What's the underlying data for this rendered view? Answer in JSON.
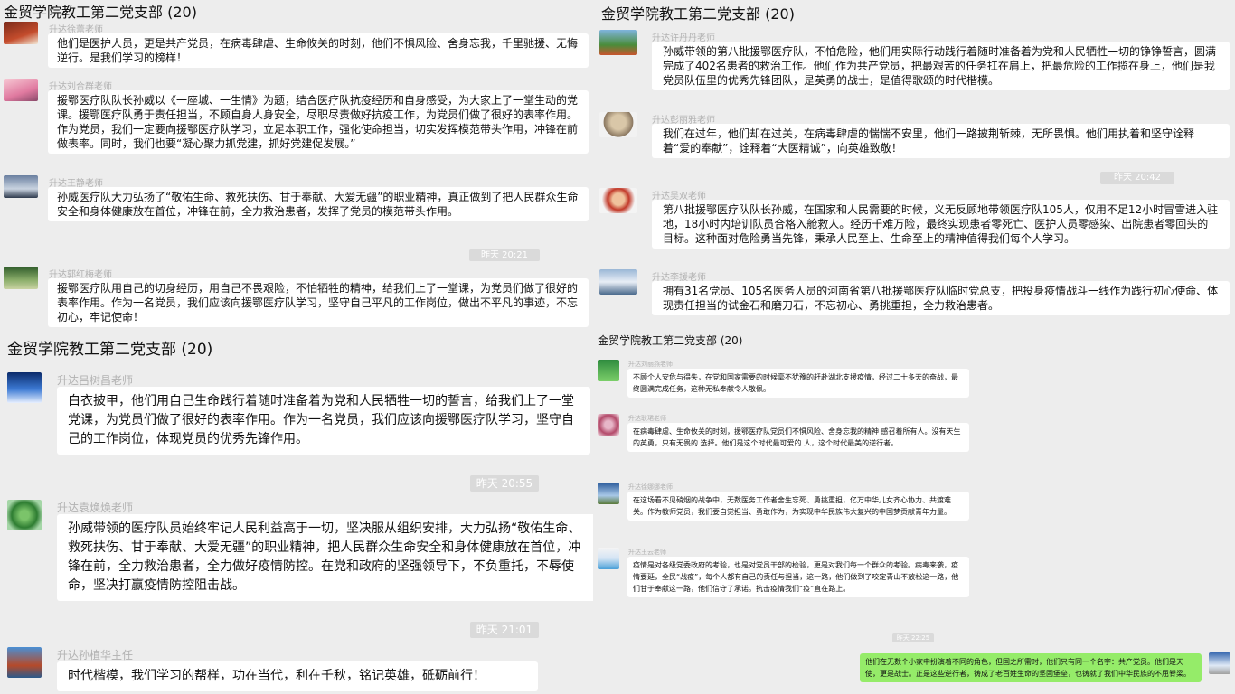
{
  "group_title": "金贸学院教工第二党支部 (20)",
  "top_left": {
    "messages": [
      {
        "sender": "升达徐蕾老师",
        "text": "他们是医护人员，更是共产党员，在病毒肆虐、生命攸关的时刻，他们不惧风险、舍身忘我，千里驰援、无悔逆行。是我们学习的榜样！"
      },
      {
        "sender": "升达刘合群老师",
        "text": "援鄂医疗队队长孙威以《一座城、一生情》为题，结合医疗队抗疫经历和自身感受，为大家上了一堂生动的党课。援鄂医疗队勇于责任担当，不顾自身人身安全，尽职尽责做好抗疫工作，为党员们做了很好的表率作用。作为党员，我们一定要向援鄂医疗队学习，立足本职工作，强化使命担当，切实发挥模范带头作用，冲锋在前做表率。同时，我们也要“凝心聚力抓党建，抓好党建促发展。”"
      },
      {
        "sender": "升达王静老师",
        "text": "孙威医疗队大力弘扬了“敬佑生命、救死扶伤、甘于奉献、大爱无疆”的职业精神，真正做到了把人民群众生命安全和身体健康放在首位，冲锋在前，全力救治患者，发挥了党员的模范带头作用。"
      },
      {
        "sender": "升达郭红梅老师",
        "text": "援鄂医疗队用自己的切身经历，用自己不畏艰险，不怕牺牲的精神，给我们上了一堂课，为党员们做了很好的表率作用。作为一名党员，我们应该向援鄂医疗队学习，坚守自己平凡的工作岗位，做出不平凡的事迹，不忘初心，牢记使命！"
      }
    ],
    "time": "昨天 20:21"
  },
  "top_right": {
    "messages": [
      {
        "sender": "升达许丹丹老师",
        "text": "孙威带领的第八批援鄂医疗队，不怕危险，他们用实际行动践行着随时准备着为党和人民牺牲一切的铮铮誓言，圆满完成了402名患者的救治工作。他们作为共产党员，把最艰苦的任务扛在肩上，把最危险的工作揽在身上，他们是我党员队伍里的优秀先锋团队，是英勇的战士，是值得歌颂的时代楷模。"
      },
      {
        "sender": "升达彭丽雅老师",
        "text": "我们在过年，他们却在过关，在病毒肆虐的惴惴不安里，他们一路披荆斩棘，无所畏惧。他们用执着和坚守诠释着“爱的奉献”，诠释着“大医精诚”，向英雄致敬！"
      },
      {
        "sender": "升达吴双老师",
        "text": "第八批援鄂医疗队队长孙威，在国家和人民需要的时候，义无反顾地带领医疗队105人，仅用不足12小时冒雪进入驻地，18小时内培训队员合格入舱救人。经历千难万险，最终实现患者零死亡、医护人员零感染、出院患者零回头的目标。这种面对危险勇当先锋，秉承人民至上、生命至上的精神值得我们每个人学习。"
      },
      {
        "sender": "升达李援老师",
        "text": "拥有31名党员、105名医务人员的河南省第八批援鄂医疗队临时党总支，把投身疫情战斗一线作为践行初心使命、体现责任担当的试金石和磨刀石，不忘初心、勇挑重担，全力救治患者。"
      }
    ],
    "time": "昨天 20:42"
  },
  "bottom_left": {
    "messages": [
      {
        "sender": "升达吕树昌老师",
        "text": "白衣披甲，他们用自己生命践行着随时准备着为党和人民牺牲一切的誓言，给我们上了一堂党课，为党员们做了很好的表率作用。作为一名党员，我们应该向援鄂医疗队学习，坚守自己的工作岗位，体现党员的优秀先锋作用。"
      },
      {
        "sender": "升达袁焕焕老师",
        "text": " 孙威带领的医疗队员始终牢记人民利益高于一切，坚决服从组织安排，大力弘扬“敬佑生命、救死扶伤、甘于奉献、大爱无疆”的职业精神，把人民群众生命安全和身体健康放在首位，冲锋在前，全力救治患者，全力做好疫情防控。在党和政府的坚强领导下，不负重托，不辱使命，坚决打赢疫情防控阻击战。"
      },
      {
        "sender": "升达孙植华主任",
        "text": "时代楷模，我们学习的帮样，功在当代，利在千秋，铭记英雄，砥砺前行！"
      }
    ],
    "times": [
      "昨天 20:55",
      "昨天 21:01"
    ]
  },
  "bottom_right": {
    "messages": [
      {
        "sender": "升达刘丽燕老师",
        "text": "不顾个人安危与得失，在党和国家需要的时候毫不犹豫的赶赴湖北支援疫情，经过二十多天的奋战，最终圆满完成任务，这种无私奉献令人敬佩。"
      },
      {
        "sender": "升达耿珺老师",
        "text": "在病毒肆虐、生命攸关的时刻，援鄂医疗队党员们不惧风险、舍身忘我的精神 感召着所有人。没有天生的英勇，只有无畏的 选择。他们是这个时代最可爱的 人，这个时代最美的逆行者。"
      },
      {
        "sender": "升达徐娜娜老师",
        "text": "在这场看不见硝烟的战争中，无数医务工作者舍生忘死、勇挑重担，亿万中华儿女齐心协力、共渡难关。作为教师党员，我们要自觉担当、勇敢作为，为实现中华民族伟大复兴的中国梦贡献青年力量。"
      },
      {
        "sender": "升达王云老师",
        "text": "疫情是对各级党委政府的考验，也是对党员干部的检验，更是对我们每一个群众的考验。病毒来袭，疫情要延，全民“战疫”，每个人都有自己的责任与担当，这一路，他们做到了咬定青山不放松这一路，他们甘于奉献这一路，他们信守了承诺。抗击疫情我们“疫”直在路上。"
      }
    ],
    "time": "昨天 22:25",
    "own_message": "他们在无数个小家中扮演着不同的角色，但国之所需时，他们只有同一个名字：共产党员。他们是天使，更是战士。正是这些逆行者，铸成了老百姓生命的坚固堡垒，也铸就了我们中华民族的不屈脊梁。"
  }
}
